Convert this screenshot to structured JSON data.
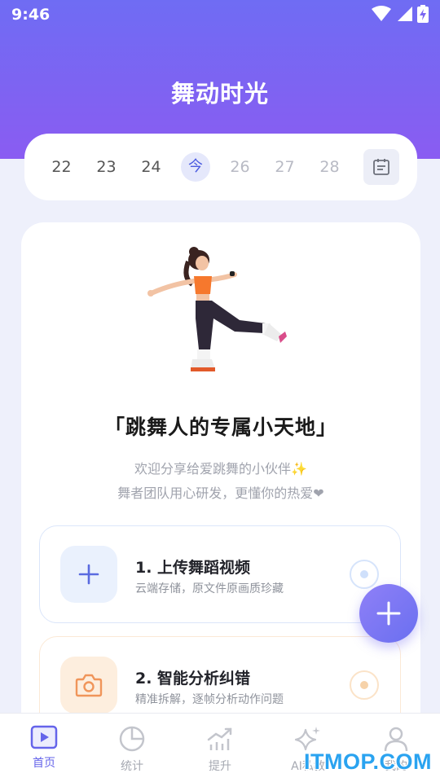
{
  "status_bar": {
    "time": "9:46",
    "icons": [
      "wifi-icon",
      "cellular-signal-icon",
      "battery-charging-icon"
    ]
  },
  "app_title": "舞动时光",
  "date_strip": {
    "dates": [
      {
        "label": "22",
        "state": "past"
      },
      {
        "label": "23",
        "state": "past"
      },
      {
        "label": "24",
        "state": "past"
      },
      {
        "label": "今",
        "state": "today"
      },
      {
        "label": "26",
        "state": "future"
      },
      {
        "label": "27",
        "state": "future"
      },
      {
        "label": "28",
        "state": "future"
      }
    ],
    "calendar_icon": "calendar-icon"
  },
  "hero": {
    "slogan": "「跳舞人的专属小天地」",
    "intro_line1": "欢迎分享给爱跳舞的小伙伴✨",
    "intro_line2": "舞者团队用心研发，更懂你的热爱❤"
  },
  "steps": [
    {
      "title": "1. 上传舞蹈视频",
      "desc": "云端存储，原文件原画质珍藏",
      "icon": "plus-icon"
    },
    {
      "title": "2. 智能分析纠错",
      "desc": "精准拆解，逐帧分析动作问题",
      "icon": "camera-icon"
    }
  ],
  "fab_icon": "plus-icon",
  "bottom_nav": [
    {
      "label": "首页",
      "icon": "video-play-icon",
      "active": true
    },
    {
      "label": "统计",
      "icon": "pie-chart-icon",
      "active": false
    },
    {
      "label": "提升",
      "icon": "trend-chart-icon",
      "active": false
    },
    {
      "label": "AI私教",
      "icon": "sparkle-icon",
      "active": false
    },
    {
      "label": "我的",
      "icon": "user-icon",
      "active": false
    }
  ],
  "watermark": "ITMOP.COM",
  "colors": {
    "header_gradient_top": "#6f6cf3",
    "header_gradient_bottom": "#8a5cf2",
    "accent": "#6564ea",
    "today_bg": "#e5e8fb",
    "upload_tint": "#eaf1fd",
    "analyze_tint": "#fdeede",
    "watermark": "#2aa3f0"
  }
}
